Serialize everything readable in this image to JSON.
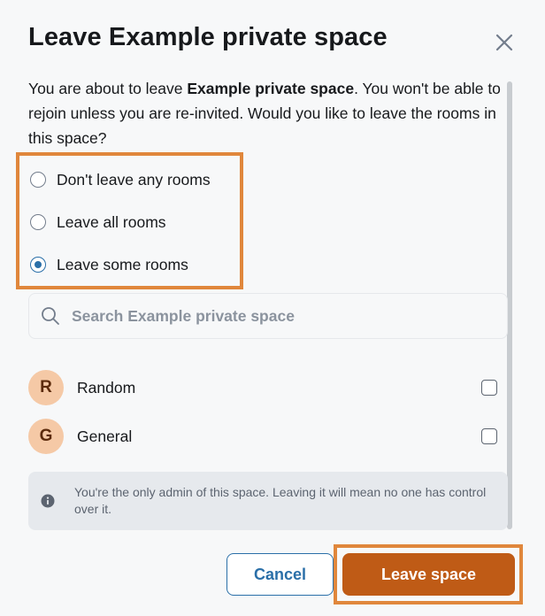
{
  "dialog": {
    "title": "Leave Example private space",
    "intro_prefix": "You are about to leave ",
    "intro_bold": "Example private space",
    "intro_suffix": ". You won't be able to rejoin unless you are re-invited. Would you like to leave the rooms in this space?"
  },
  "options": [
    {
      "label": "Don't leave any rooms",
      "checked": false
    },
    {
      "label": "Leave all rooms",
      "checked": false
    },
    {
      "label": "Leave some rooms",
      "checked": true
    }
  ],
  "search": {
    "placeholder": "Search Example private space",
    "value": ""
  },
  "rooms": [
    {
      "initial": "R",
      "name": "Random",
      "checked": false
    },
    {
      "initial": "G",
      "name": "General",
      "checked": false
    }
  ],
  "notice": {
    "text": "You're the only admin of this space. Leaving it will mean no one has control over it."
  },
  "buttons": {
    "cancel": "Cancel",
    "leave": "Leave space"
  },
  "colors": {
    "accent": "#2a6fa8",
    "primary_button": "#bf5b16",
    "highlight": "#e0873c",
    "avatar_bg": "#f5c9a6"
  }
}
